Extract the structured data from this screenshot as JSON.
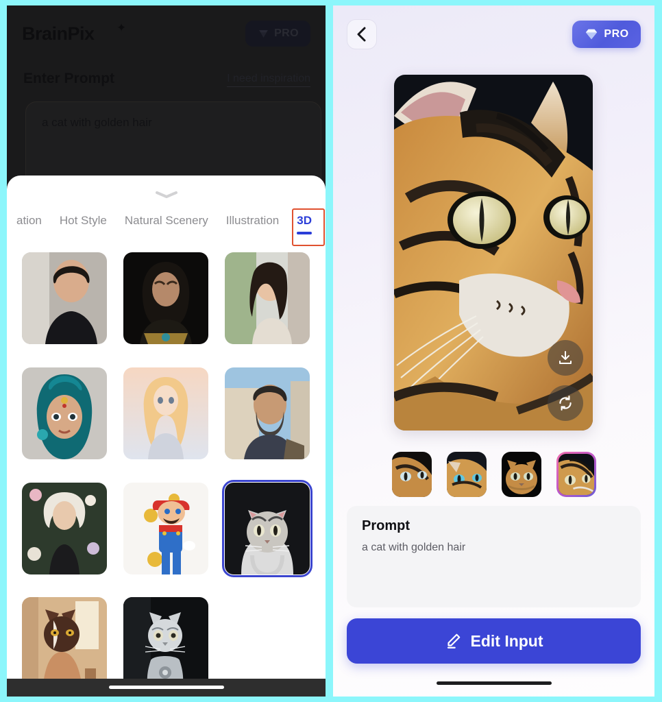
{
  "theme": {
    "outer_background": "#8cf6fb",
    "accent_blue": "#3b45d6",
    "tab_active": "#2b3ed8",
    "annotation_red": "#e0512f",
    "thumb_selected_gradient": "pink-to-purple"
  },
  "left_panel": {
    "brand": "BrainPix",
    "brand_star": "✦",
    "pro_label": "PRO",
    "section_title": "Enter Prompt",
    "inspiration_link": "I need inspiration",
    "prompt_value": "a cat with golden hair",
    "prompt_placeholder": "Enter Prompt",
    "sheet": {
      "handle": "chevron-down",
      "tabs": [
        {
          "label": "ation",
          "active": false
        },
        {
          "label": "Hot Style",
          "active": false
        },
        {
          "label": "Natural Scenery",
          "active": false
        },
        {
          "label": "Illustration",
          "active": false
        },
        {
          "label": "3D",
          "active": true
        }
      ],
      "grid_items": [
        {
          "name": "young-man-portrait",
          "selected": false
        },
        {
          "name": "hooded-sorcerer",
          "selected": false
        },
        {
          "name": "smiling-woman-outdoors",
          "selected": false
        },
        {
          "name": "teal-haired-princess",
          "selected": false
        },
        {
          "name": "blonde-anime-girl",
          "selected": false
        },
        {
          "name": "bearded-warrior-street",
          "selected": false
        },
        {
          "name": "white-haired-girl-flowers",
          "selected": false
        },
        {
          "name": "mario-character",
          "selected": false
        },
        {
          "name": "hooded-tabby-cat",
          "selected": true
        },
        {
          "name": "siamese-cat-interior",
          "selected": false
        },
        {
          "name": "robot-cat",
          "selected": false
        }
      ]
    }
  },
  "right_panel": {
    "back_icon": "chevron-left-icon",
    "pro_label": "PRO",
    "hero_image_alt": "golden tabby cat close-up",
    "hero_actions": [
      {
        "name": "download-button",
        "icon": "download-icon"
      },
      {
        "name": "regenerate-button",
        "icon": "refresh-icon"
      }
    ],
    "thumbnails": [
      {
        "name": "variant-1",
        "selected": false
      },
      {
        "name": "variant-2",
        "selected": false
      },
      {
        "name": "variant-3",
        "selected": false
      },
      {
        "name": "variant-4",
        "selected": true
      }
    ],
    "prompt_heading": "Prompt",
    "prompt_value": "a cat with golden hair",
    "edit_button_label": "Edit Input",
    "edit_button_icon": "pencil-icon"
  }
}
